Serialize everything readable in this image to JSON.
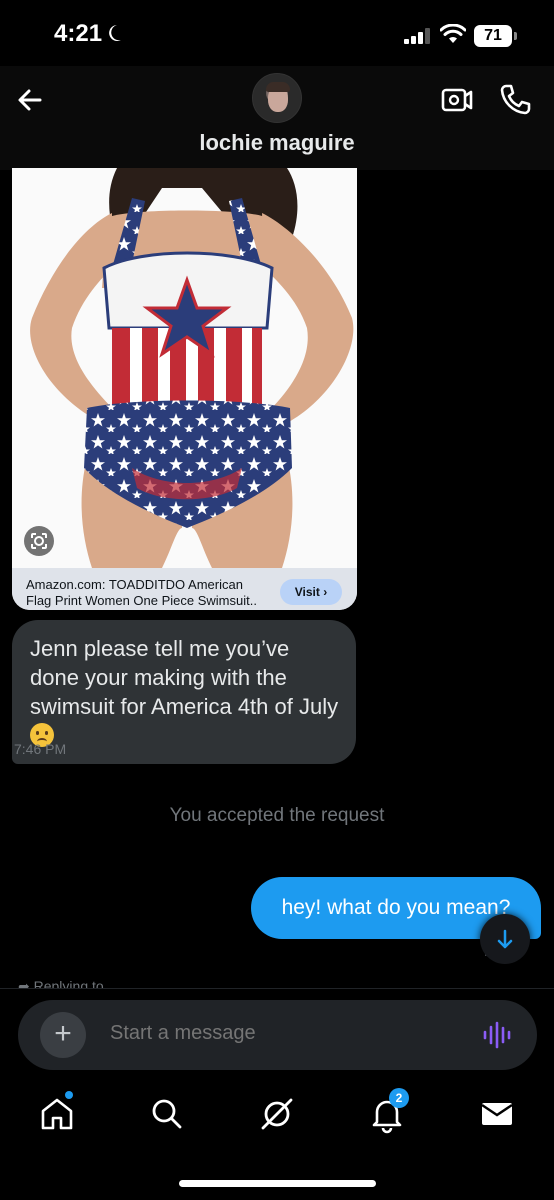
{
  "status_bar": {
    "time": "4:21",
    "battery": "71"
  },
  "header": {
    "contact_name": "lochie maguire",
    "icons": [
      "back-arrow-icon",
      "video-call-icon",
      "phone-call-icon"
    ]
  },
  "shared_link": {
    "title": "Amazon.com: TOADDITDO American Flag Print Women One Piece Swimsuit..",
    "button_label": "Visit ›"
  },
  "messages": [
    {
      "direction": "incoming",
      "text": "Jenn please tell me you’ve done your making with the swimsuit for America 4th of July",
      "emoji": "slightly-frowning-face",
      "time": "7:46 PM"
    },
    {
      "direction": "system",
      "text": "You accepted the request"
    },
    {
      "direction": "outgoing",
      "text": "hey! what do you mean?",
      "time_visible": "M"
    }
  ],
  "replying_to": "Replying to",
  "composer": {
    "placeholder": "Start a message",
    "add_label": "+"
  },
  "nav": {
    "items": [
      "home",
      "search",
      "grok",
      "notifications",
      "messages"
    ],
    "notification_count": "2"
  },
  "colors": {
    "accent": "#1d9bf0",
    "bubble_incoming": "#2f3336",
    "muted_text": "#71767b",
    "voice_icon": "#8b5cf6"
  }
}
